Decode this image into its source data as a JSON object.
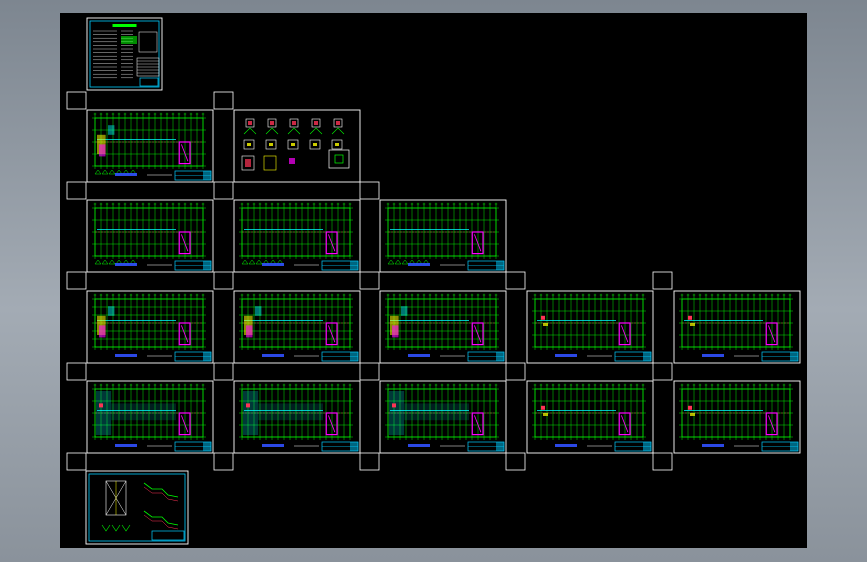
{
  "viewer": {
    "background_top": "#7d8690",
    "background_bottom": "#8a929b",
    "canvas_color": "#000000"
  },
  "colors": {
    "sheet_border": "#ffffff",
    "grid_line": "#00ff00",
    "axis_line": "#ff3355",
    "title_block": "#00ccff",
    "detail_magenta": "#ff00ff",
    "detail_yellow": "#ffff00",
    "detail_cyan": "#00ffff"
  },
  "sheets": [
    {
      "id": "design-notes",
      "kind": "notes"
    },
    {
      "id": "foundation-plan",
      "kind": "plan"
    },
    {
      "id": "foundation-details",
      "kind": "details"
    },
    {
      "id": "column-plan-1",
      "kind": "plan"
    },
    {
      "id": "column-plan-2",
      "kind": "plan"
    },
    {
      "id": "column-plan-3",
      "kind": "plan"
    },
    {
      "id": "beam-plan-1",
      "kind": "plan-dense"
    },
    {
      "id": "beam-plan-2",
      "kind": "plan-dense"
    },
    {
      "id": "beam-plan-3",
      "kind": "plan-dense"
    },
    {
      "id": "beam-plan-4",
      "kind": "plan-light"
    },
    {
      "id": "beam-plan-5",
      "kind": "plan-light"
    },
    {
      "id": "slab-plan-1",
      "kind": "plan-slab"
    },
    {
      "id": "slab-plan-2",
      "kind": "plan-slab"
    },
    {
      "id": "slab-plan-3",
      "kind": "plan-slab"
    },
    {
      "id": "slab-plan-4",
      "kind": "plan-light"
    },
    {
      "id": "slab-plan-5",
      "kind": "plan-light"
    },
    {
      "id": "stair-details",
      "kind": "stairs"
    }
  ]
}
